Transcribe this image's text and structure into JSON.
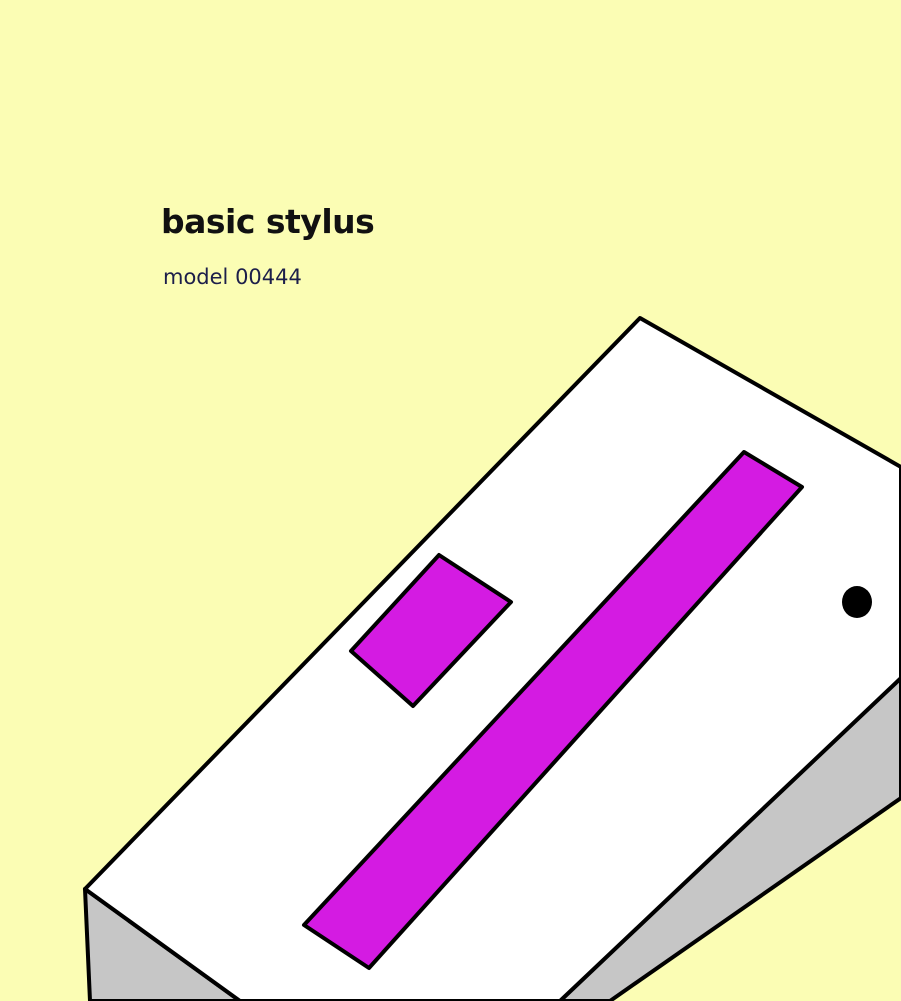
{
  "title": "basic stylus",
  "subtitle": "model 00444",
  "colors": {
    "background": "#fbfdb4",
    "device_top": "#ffffff",
    "device_side": "#c6c6c6",
    "accent": "#d41be2",
    "outline": "#000000",
    "indicator": "#000000"
  },
  "icons": {
    "indicator": "indicator-dot-icon"
  }
}
